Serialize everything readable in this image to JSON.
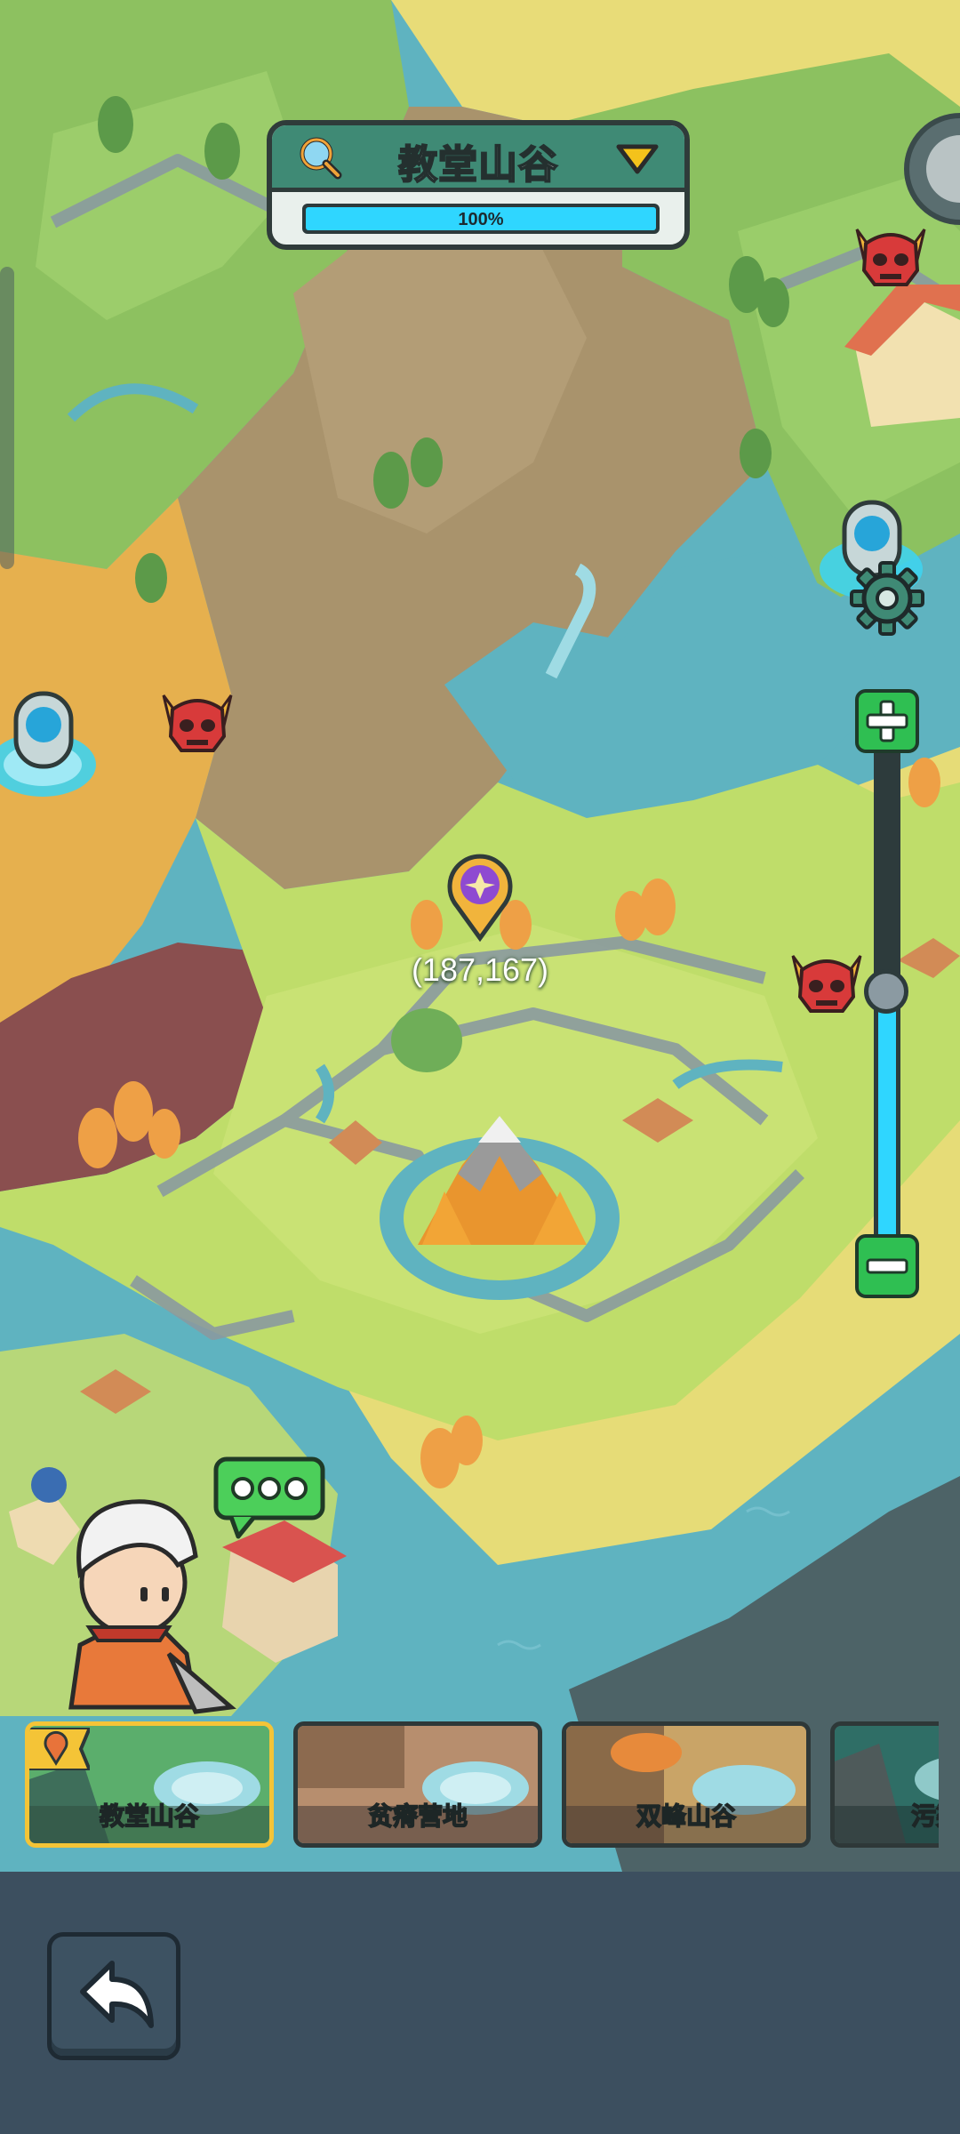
{
  "region": {
    "title": "教堂山谷",
    "progress_text": "100%",
    "progress_value": 1.0
  },
  "map": {
    "coordinate": "(187,167)",
    "zoom_level": 0.5
  },
  "regions": [
    {
      "label": "教堂山谷",
      "selected": true
    },
    {
      "label": "贫瘠营地",
      "selected": false
    },
    {
      "label": "双峰山谷",
      "selected": false
    },
    {
      "label": "污染",
      "selected": false
    }
  ],
  "icons": {
    "search": "search-icon",
    "dropdown": "chevron-down-icon",
    "settings": "gear-icon",
    "zoom_in": "plus-icon",
    "zoom_out": "minus-icon",
    "back": "back-arrow-icon",
    "location_pin": "location-pin-icon",
    "enemy": "red-demon-skull-icon",
    "portal": "portal-icon",
    "chat": "chat-bubble-icon",
    "hero": "hero-avatar"
  },
  "colors": {
    "progress": "#2fd6ff",
    "zoom_button": "#2fbf52",
    "selected_border": "#f4c437",
    "title_bar": "#3f8a75",
    "bottom_bar": "#3c4f5f"
  }
}
